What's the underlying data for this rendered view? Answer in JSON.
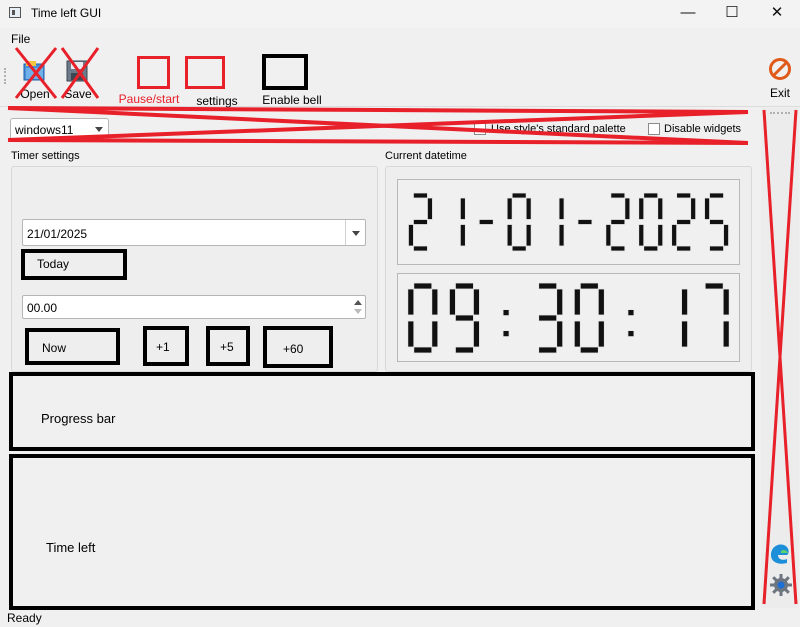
{
  "window": {
    "title": "Time left GUI",
    "minimize_glyph": "—",
    "maximize_glyph": "☐",
    "close_glyph": "✕"
  },
  "menu": {
    "file_label": "File"
  },
  "toolbar": {
    "open_label": "Open",
    "save_label": "Save",
    "pause_start_label": "Pause/start",
    "settings_label": "settings",
    "enable_bell_label": "Enable bell",
    "exit_label": "Exit"
  },
  "style_bar": {
    "style_value": "windows11",
    "standard_palette_label": "Use style's standard palette",
    "disable_widgets_label": "Disable widgets"
  },
  "timer_settings": {
    "title": "Timer settings",
    "date_value": "21/01/2025",
    "today_label": "Today",
    "time_value": "00.00",
    "now_label": "Now",
    "plus1_label": "+1",
    "plus5_label": "+5",
    "plus60_label": "+60"
  },
  "current_datetime": {
    "title": "Current datetime",
    "date_display": "21-01-2025",
    "time_display": "09:30:17"
  },
  "progress_label": "Progress bar",
  "time_left_label": "Time left",
  "status_text": "Ready",
  "colors": {
    "annotation_red": "#e8202a",
    "annotation_black": "#000000",
    "window_bg": "#f0f0f0"
  },
  "icons": [
    "app-icon",
    "open-icon",
    "save-icon",
    "exit-icon",
    "edge-icon",
    "settings-gear-icon"
  ]
}
